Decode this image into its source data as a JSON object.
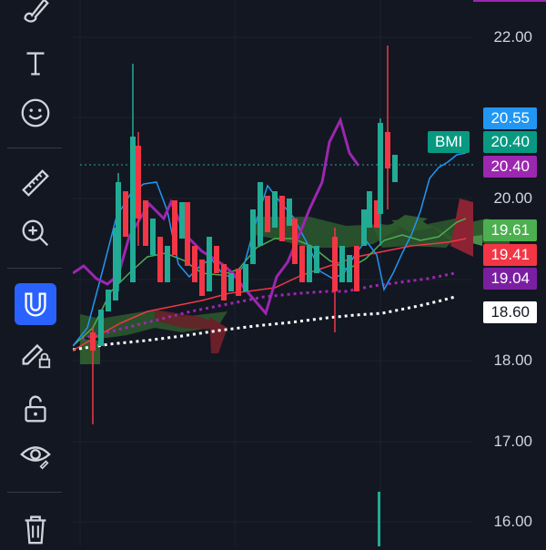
{
  "toolbar": {
    "tools": [
      {
        "name": "brush-tool",
        "icon": "brush-icon"
      },
      {
        "name": "text-tool",
        "icon": "text-icon"
      },
      {
        "name": "emoji-tool",
        "icon": "smiley-icon"
      },
      {
        "name": "ruler-tool",
        "icon": "ruler-icon"
      },
      {
        "name": "zoom-in-tool",
        "icon": "zoom-in-icon"
      },
      {
        "name": "magnet-tool",
        "icon": "magnet-icon",
        "active": true
      },
      {
        "name": "lock-drawing-tool",
        "icon": "pencil-lock-icon"
      },
      {
        "name": "unlock-tool",
        "icon": "unlock-icon"
      },
      {
        "name": "hide-tool",
        "icon": "eye-icon"
      },
      {
        "name": "delete-tool",
        "icon": "trash-icon"
      }
    ]
  },
  "price_axis": {
    "labels": [
      "22.00",
      "20.00",
      "18.00",
      "17.00",
      "16.00"
    ]
  },
  "badges": {
    "blue": {
      "text": "20.55",
      "color": "#2196f3"
    },
    "bmi_tag": {
      "text": "BMI",
      "color": "#089981"
    },
    "bmi_price": {
      "text": "20.40",
      "color": "#089981"
    },
    "purple_top": {
      "text": "20.40",
      "color": "#9c27b0"
    },
    "green": {
      "text": "19.61",
      "color": "#4caf50"
    },
    "red": {
      "text": "19.41",
      "color": "#f23645"
    },
    "purple_low": {
      "text": "19.04",
      "color": "#7b1fa2"
    },
    "white": {
      "text": "18.60",
      "color": "#ffffff"
    }
  },
  "colors": {
    "up": "#22ab94",
    "down": "#f23645",
    "accent": "#2962ff"
  }
}
